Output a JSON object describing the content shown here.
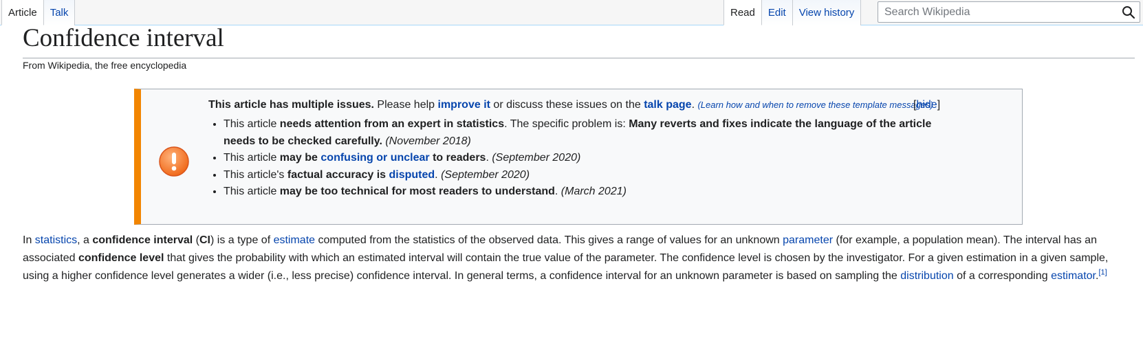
{
  "tabs": {
    "left": [
      {
        "label": "Article",
        "selected": true
      },
      {
        "label": "Talk",
        "selected": false
      }
    ],
    "right": [
      {
        "label": "Read",
        "selected": true
      },
      {
        "label": "Edit",
        "selected": false
      },
      {
        "label": "View history",
        "selected": false
      }
    ]
  },
  "search": {
    "placeholder": "Search Wikipedia",
    "icon": "search-icon"
  },
  "page": {
    "title": "Confidence interval",
    "tagline": "From Wikipedia, the free encyclopedia"
  },
  "ambox": {
    "heading_bold": "This article has multiple issues.",
    "heading_text1": " Please help ",
    "improve_link": "improve it",
    "heading_text2": " or discuss these issues on the ",
    "talk_link": "talk page",
    "heading_text3": ". ",
    "learn_link": "(Learn how and when to remove these template messages)",
    "hide_open": "[",
    "hide_label": "hide",
    "hide_close": "]",
    "accent_color": "#f28500",
    "icon": "warning-icon",
    "issues": [
      {
        "t1": "This article ",
        "b1": "needs attention from an expert in statistics",
        "t2": ". The specific problem is: ",
        "b2": "Many reverts and fixes indicate the language of the article needs to be checked carefully.",
        "date": " (November 2018)"
      },
      {
        "t1": "This article ",
        "b1": "may be ",
        "link": "confusing or unclear",
        "b2": " to readers",
        "t2": ".",
        "date": " (September 2020)"
      },
      {
        "t1": "This article's ",
        "b1": "factual accuracy is ",
        "link": "disputed",
        "t2": ".",
        "date": " (September 2020)"
      },
      {
        "t1": "This article ",
        "b1": "may be too technical for most readers to understand",
        "t2": ".",
        "date": " (March 2021)"
      }
    ]
  },
  "intro": {
    "p1": "In ",
    "l_statistics": "statistics",
    "p2": ", a ",
    "b_ci": "confidence interval",
    "p3": " (",
    "b_abbr": "CI",
    "p4": ") is a type of ",
    "l_estimate": "estimate",
    "p5": " computed from the statistics of the observed data. This gives a range of values for an unknown ",
    "l_parameter": "parameter",
    "p6": " (for example, a population mean). The interval has an associated ",
    "b_level": "confidence level",
    "p7": " that gives the probability with which an estimated interval will contain the true value of the parameter. The confidence level is chosen by the investigator. For a given estimation in a given sample, using a higher confidence level generates a wider (i.e., less precise) confidence interval. In general terms, a confidence interval for an unknown parameter is based on sampling the ",
    "l_distribution": "distribution",
    "p8": " of a corresponding ",
    "l_estimator": "estimator",
    "p9": ".",
    "ref": "[1]"
  },
  "colors": {
    "link": "#0645ad",
    "text": "#202122",
    "border": "#a2a9b1"
  }
}
